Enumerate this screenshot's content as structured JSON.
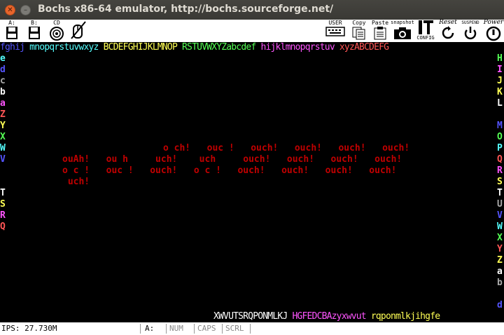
{
  "window": {
    "title": "Bochs x86-64 emulator, http://bochs.sourceforge.net/"
  },
  "toolbar": {
    "items": [
      {
        "label": "A:",
        "icon": "floppy-a-icon"
      },
      {
        "label": "B:",
        "icon": "floppy-b-icon"
      },
      {
        "label": "CD",
        "icon": "cdrom-icon"
      },
      {
        "label": "",
        "icon": "mouse-icon"
      },
      {
        "label": "USER",
        "icon": "keyboard-icon"
      },
      {
        "label": "Copy",
        "icon": "copy-icon"
      },
      {
        "label": "Paste",
        "icon": "paste-icon"
      },
      {
        "label": "snapshot",
        "icon": "camera-icon"
      },
      {
        "label": "CONFIG",
        "icon": "config-icon"
      },
      {
        "label": "Reset",
        "icon": "reset-icon"
      },
      {
        "label": "SUSPEND",
        "icon": "suspend-icon"
      },
      {
        "label": "Power",
        "icon": "power-icon"
      }
    ]
  },
  "screen": {
    "top_row": {
      "segments": [
        {
          "text": "fghij",
          "color": "#5555ff"
        },
        {
          "text": " mnopqrstuvwxyz ",
          "color": "#55ffff"
        },
        {
          "text": "BCDEFGHIJKLMNOP ",
          "color": "#ffff55"
        },
        {
          "text": "RSTUVWXYZabcdef ",
          "color": "#55ff55"
        },
        {
          "text": "hijklmnopqrstuv ",
          "color": "#ff55ff"
        },
        {
          "text": "xyzABCDEFG",
          "color": "#ff5555"
        }
      ]
    },
    "left_column": [
      "e",
      "d",
      "c",
      "b",
      "a",
      "Z",
      "Y",
      "X",
      "W",
      "V",
      "",
      "",
      "T",
      "S",
      "R",
      "Q"
    ],
    "left_colors": [
      "#55ffff",
      "#5555ff",
      "#aaaaaa",
      "#ffffff",
      "#ff55ff",
      "#ff5555",
      "#ffff55",
      "#55ff55",
      "#55ffff",
      "#5555ff",
      "",
      "",
      "#ffffff",
      "#ffff55",
      "#ff55ff",
      "#ff5555"
    ],
    "right_column": [
      "H",
      "I",
      "J",
      "K",
      "L",
      "",
      "M",
      "O",
      "P",
      "Q",
      "R",
      "S",
      "T",
      "U",
      "V",
      "W",
      "X",
      "Y",
      "Z",
      "a",
      "b",
      "",
      "d"
    ],
    "right_colors": [
      "#55ff55",
      "#ff55ff",
      "#ffff55",
      "#ffff55",
      "#ffffff",
      "",
      "#5555ff",
      "#55ff55",
      "#55ffff",
      "#ff5555",
      "#ff55ff",
      "#ffff55",
      "#ffffff",
      "#aaaaaa",
      "#5555ff",
      "#55ffff",
      "#55ff55",
      "#ff5555",
      "#ffff55",
      "#ffffff",
      "#aaaaaa",
      "",
      "#5555ff"
    ],
    "ouch_lines": [
      "o ch!   ouc !   ouch!   ouch!   ouch!   ouch!",
      "ouAh!   ou h     uch!    uch     ouch!   ouch!   ouch!   ouch!",
      "o c !   ouc !   ouch!   o c !   ouch!   ouch!   ouch!   ouch!",
      " uch!"
    ],
    "bottom_row": {
      "segments": [
        {
          "text": "XWVUTSRQPONMLKJ ",
          "color": "#ffffff"
        },
        {
          "text": "HGFEDCBAzyxwvut ",
          "color": "#ff55ff"
        },
        {
          "text": "rqponmlkjihgfe",
          "color": "#ffff55"
        }
      ]
    }
  },
  "statusbar": {
    "ips": "IPS: 27.730M",
    "drive": "A:",
    "num": "NUM",
    "caps": "CAPS",
    "scrl": "SCRL"
  }
}
